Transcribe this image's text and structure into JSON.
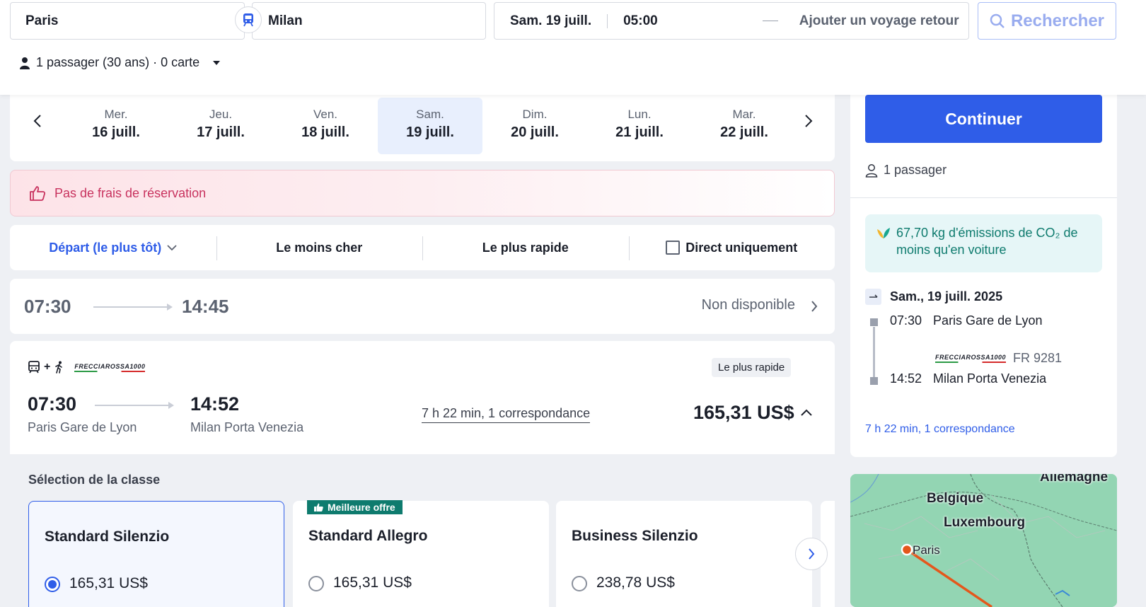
{
  "search": {
    "from": "Paris",
    "to": "Milan",
    "date": "Sam. 19 juill.",
    "time": "05:00",
    "return_label": "Ajouter un voyage retour",
    "search_button": "Rechercher",
    "passengers": "1 passager (30 ans) · 0 carte"
  },
  "dates": [
    {
      "dow": "Mer.",
      "date": "16 juill."
    },
    {
      "dow": "Jeu.",
      "date": "17 juill."
    },
    {
      "dow": "Ven.",
      "date": "18 juill."
    },
    {
      "dow": "Sam.",
      "date": "19 juill."
    },
    {
      "dow": "Dim.",
      "date": "20 juill."
    },
    {
      "dow": "Lun.",
      "date": "21 juill."
    },
    {
      "dow": "Mar.",
      "date": "22 juill."
    }
  ],
  "promo": {
    "text": "Pas de frais de réservation"
  },
  "sort": {
    "departure": "Départ (le plus tôt)",
    "cheapest": "Le moins cher",
    "fastest": "Le plus rapide",
    "direct": "Direct uniquement"
  },
  "journeys": [
    {
      "dep": "07:30",
      "arr": "14:45",
      "status": "Non disponible"
    },
    {
      "dep": "07:30",
      "arr": "14:52",
      "dep_station": "Paris Gare de Lyon",
      "arr_station": "Milan Porta Venezia",
      "duration": "7 h 22 min, 1 correspondance",
      "price": "165,31 US$",
      "badge": "Le plus rapide",
      "operator": "FRECCIAROSSA1000",
      "plus": "+"
    }
  ],
  "class_selection": {
    "title": "Sélection de la classe",
    "best_offer": "Meilleure offre",
    "classes": [
      {
        "name": "Standard Silenzio",
        "price": "165,31 US$"
      },
      {
        "name": "Standard Allegro",
        "price": "165,31 US$"
      },
      {
        "name": "Business Silenzio",
        "price": "238,78 US$"
      }
    ]
  },
  "summary": {
    "continue": "Continuer",
    "passengers": "1 passager",
    "co2": "67,70 kg d'émissions de CO₂ de moins qu'en voiture",
    "date": "Sam., 19 juill. 2025",
    "dep_time": "07:30",
    "dep_station": "Paris Gare de Lyon",
    "train": "FR 9281",
    "arr_time": "14:52",
    "arr_station": "Milan Porta Venezia",
    "duration": "7 h 22 min, 1 correspondance"
  },
  "map": {
    "labels": [
      "Allemagne",
      "Belgique",
      "Luxembourg",
      "Paris"
    ]
  },
  "colors": {
    "accent": "#2f5de8",
    "promo": "#c8325e",
    "eco": "#0e7b6e"
  }
}
